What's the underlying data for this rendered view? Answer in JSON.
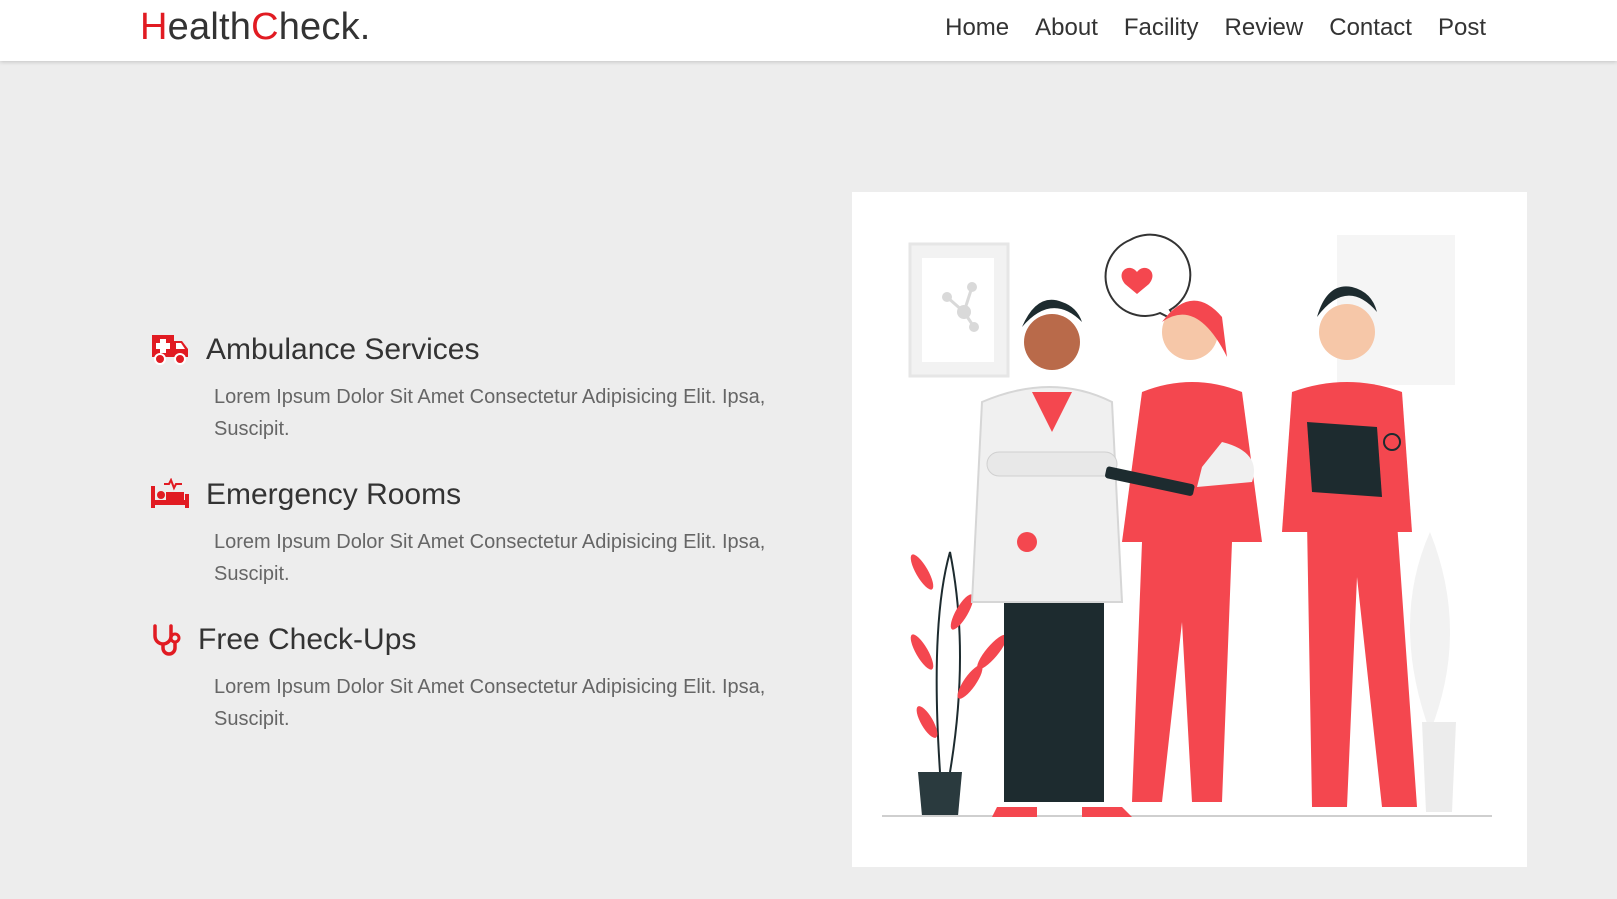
{
  "brand": {
    "parts": [
      {
        "text": "H",
        "accent": true
      },
      {
        "text": "ealth",
        "accent": false
      },
      {
        "text": "C",
        "accent": true
      },
      {
        "text": "heck.",
        "accent": false
      }
    ],
    "accent_color": "#e11b22"
  },
  "nav": {
    "items": [
      "Home",
      "About",
      "Facility",
      "Review",
      "Contact",
      "Post"
    ]
  },
  "features": [
    {
      "icon": "ambulance-icon",
      "title": "Ambulance Services",
      "desc": "Lorem Ipsum Dolor Sit Amet Consectetur Adipisicing Elit. Ipsa, Suscipit."
    },
    {
      "icon": "hospital-bed-icon",
      "title": "Emergency Rooms",
      "desc": "Lorem Ipsum Dolor Sit Amet Consectetur Adipisicing Elit. Ipsa, Suscipit."
    },
    {
      "icon": "stethoscope-icon",
      "title": "Free Check-Ups",
      "desc": "Lorem Ipsum Dolor Sit Amet Consectetur Adipisicing Elit. Ipsa, Suscipit."
    }
  ],
  "illustration": {
    "subject": "medical-staff-illustration"
  },
  "colors": {
    "page_bg": "#ededed",
    "accent": "#e11b22",
    "scrub_red": "#f4474f",
    "text": "#333333",
    "muted_text": "#666666"
  }
}
